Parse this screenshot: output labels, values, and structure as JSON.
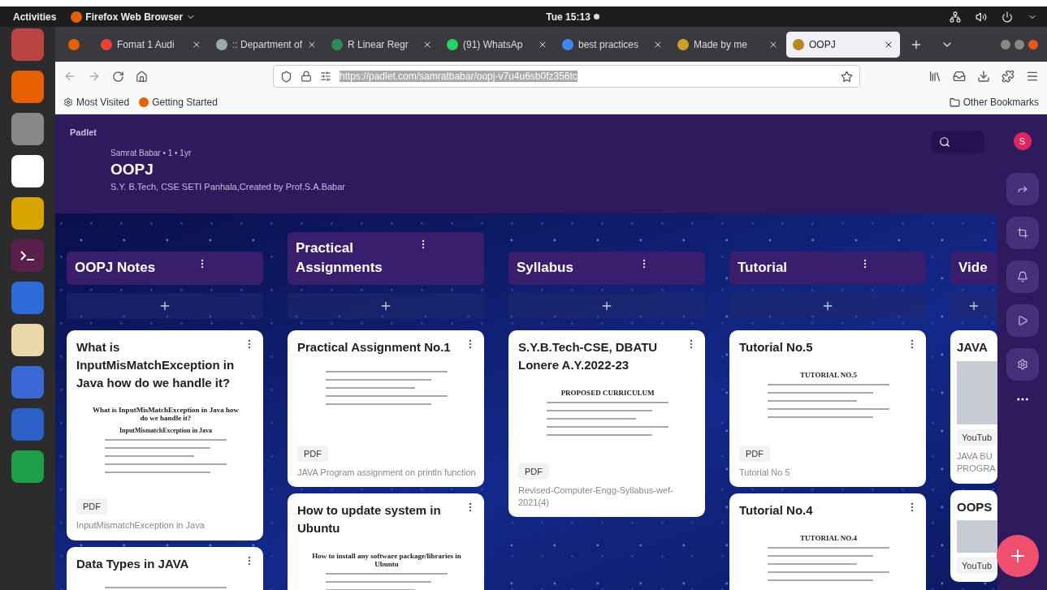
{
  "topbar": {
    "activities": "Activities",
    "app_menu": "Firefox Web Browser",
    "clock": "Tue 15:13"
  },
  "browser": {
    "tabs": [
      {
        "title": "Fomat 1 Audi",
        "selected": false
      },
      {
        "title": ":: Department of",
        "selected": false
      },
      {
        "title": "R Linear Regr",
        "selected": false
      },
      {
        "title": "(91) WhatsAp",
        "selected": false
      },
      {
        "title": "best practices",
        "selected": false
      },
      {
        "title": "Made by me",
        "selected": false
      },
      {
        "title": "OOPJ",
        "selected": true
      }
    ],
    "url": "https://padlet.com/samratbabar/oopj-v7u4u6sb0fz356tc",
    "bookmarks": [
      "Most Visited",
      "Getting Started"
    ],
    "other_bookmarks": "Other Bookmarks"
  },
  "padlet": {
    "brand": "Padlet",
    "meta": "Samrat Babar • 1 • 1yr",
    "title": "OOPJ",
    "description": "S.Y. B.Tech, CSE SETI Panhala,Created by Prof.S.A.Babar",
    "avatar": "S",
    "columns": [
      {
        "title": "OOPJ Notes",
        "cards": [
          {
            "kind": "pdf",
            "title": "What is InputMisMatchException in Java how do we handle it?",
            "preview_lines": [
              "What is InputMisMatchException in Java how do we handle it?",
              "InputMismatchException in Java"
            ],
            "badge": "PDF",
            "caption": "InputMismatchException in Java"
          },
          {
            "kind": "pdf",
            "title": "Data Types in JAVA"
          }
        ]
      },
      {
        "title": "Practical Assignments",
        "cards": [
          {
            "kind": "pdf",
            "title": "Practical Assignment No.1",
            "badge": "PDF",
            "caption": "JAVA Program assignment on println function"
          },
          {
            "kind": "pdf",
            "title": "How to update system in Ubuntu",
            "preview_lines": [
              "How to install any software package/libraries in Ubuntu"
            ]
          }
        ]
      },
      {
        "title": "Syllabus",
        "cards": [
          {
            "kind": "pdf",
            "title": "S.Y.B.Tech-CSE, DBATU Lonere A.Y.2022-23",
            "preview_lines": [
              "PROPOSED CURRICULUM"
            ],
            "badge": "PDF",
            "caption": "Revised-Computer-Engg-Syllabus-wef-2021(4)"
          }
        ]
      },
      {
        "title": "Tutorial",
        "cards": [
          {
            "kind": "pdf",
            "title": "Tutorial No.5",
            "preview_lines": [
              "TUTORIAL NO.5"
            ],
            "badge": "PDF",
            "caption": "Tutorial No 5"
          },
          {
            "kind": "pdf",
            "title": "Tutorial No.4",
            "preview_lines": [
              "TUTORIAL NO.4"
            ]
          }
        ]
      },
      {
        "title": "Vide",
        "cards": [
          {
            "kind": "youtube",
            "title": "JAVA",
            "badge": "YouTub",
            "caption": "JAVA BU PROGRA"
          },
          {
            "kind": "youtube",
            "title": "OOPS",
            "badge": "YouTub"
          }
        ]
      }
    ]
  }
}
